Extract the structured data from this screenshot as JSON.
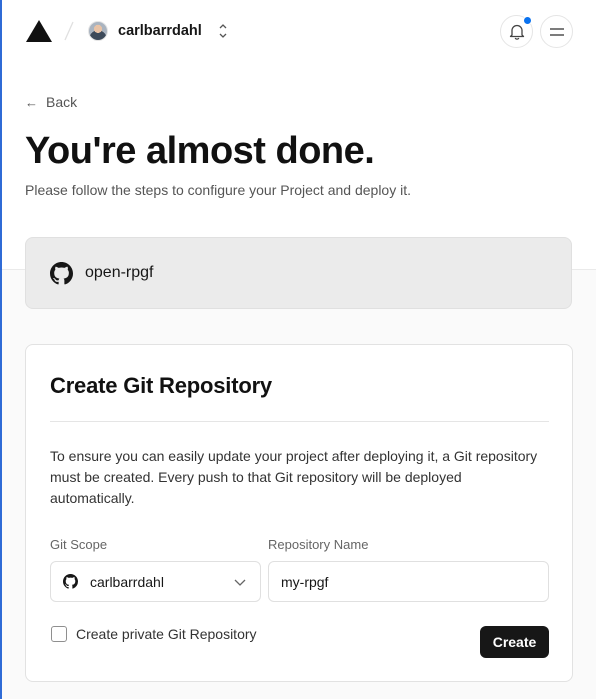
{
  "header": {
    "scope_name": "carlbarrdahl",
    "has_notification": true
  },
  "back_label": "Back",
  "hero": {
    "title": "You're almost done.",
    "subtitle": "Please follow the steps to configure your Project and deploy it."
  },
  "repo": {
    "name": "open-rpgf",
    "icon": "github-icon"
  },
  "form": {
    "title": "Create Git Repository",
    "description": "To ensure you can easily update your project after deploying it, a Git repository must be created. Every push to that Git repository will be deployed automatically.",
    "git_scope_label": "Git Scope",
    "git_scope_value": "carlbarrdahl",
    "repo_name_label": "Repository Name",
    "repo_name_value": "my-rpgf",
    "private_label": "Create private Git Repository",
    "private_checked": false,
    "create_label": "Create"
  },
  "colors": {
    "accent": "#0a72ef",
    "button_bg": "#171717",
    "repo_card_bg": "#ebebeb"
  }
}
